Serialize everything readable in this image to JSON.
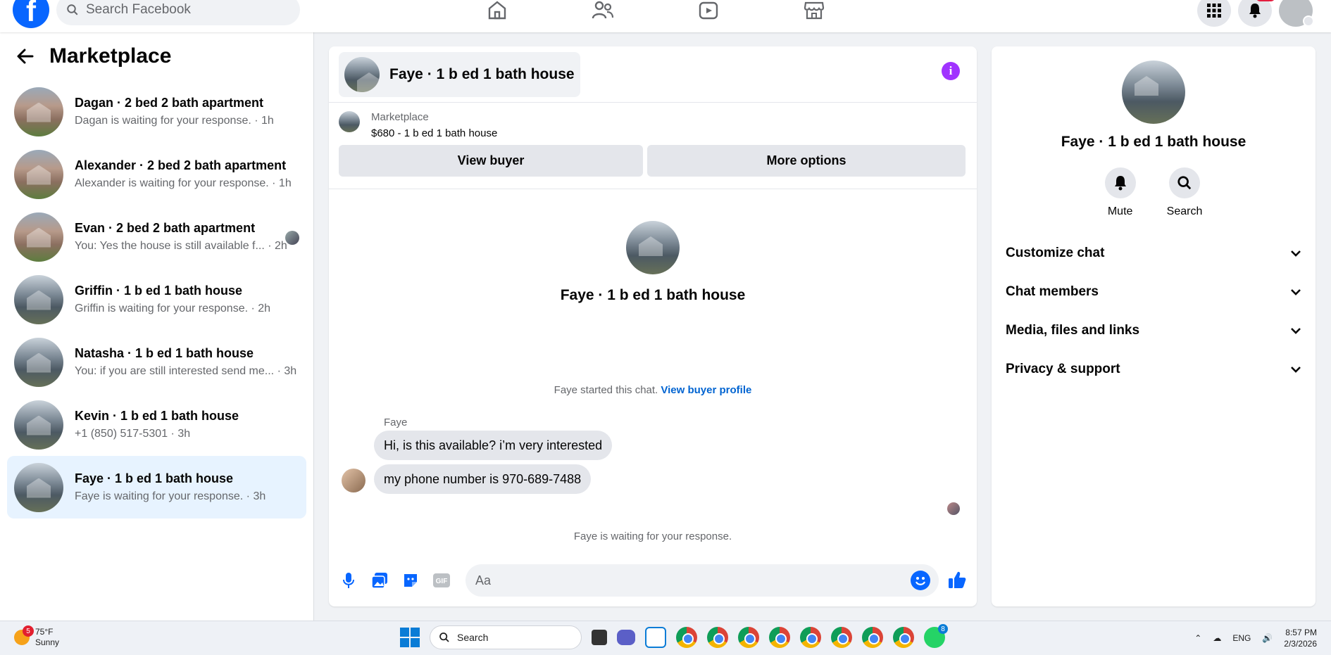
{
  "topbar": {
    "search_placeholder": "Search Facebook",
    "logo_letter": "f"
  },
  "sidebar": {
    "title": "Marketplace",
    "chats": [
      {
        "name": "Dagan · 2 bed 2 bath apartment",
        "preview": "Dagan is waiting for your response. · 1h",
        "photo": "brick"
      },
      {
        "name": "Alexander · 2 bed 2 bath apartment",
        "preview": "Alexander is waiting for your response. · 1h",
        "photo": "brick"
      },
      {
        "name": "Evan · 2 bed 2 bath apartment",
        "preview": "You: Yes the house is still available f... · 2h",
        "photo": "brick"
      },
      {
        "name": "Griffin · 1 b ed 1 bath house",
        "preview": "Griffin is waiting for your response. · 2h",
        "photo": "modern"
      },
      {
        "name": "Natasha · 1 b ed 1 bath house",
        "preview": "You: if you are still interested send me... · 3h",
        "photo": "modern"
      },
      {
        "name": "Kevin · 1 b ed 1 bath house",
        "preview": "+1 (850) 517-5301 · 3h",
        "photo": "modern"
      },
      {
        "name": "Faye · 1 b ed 1 bath house",
        "preview": "Faye is waiting for your response. · 3h",
        "photo": "modern",
        "active": true
      }
    ]
  },
  "conversation": {
    "title": "Faye · 1 b ed 1 bath house",
    "info_icon": "i",
    "marketplace_label": "Marketplace",
    "listing": "$680 - 1 b ed 1 bath house",
    "view_buyer": "View buyer",
    "more_options": "More options",
    "profile_name": "Faye · 1 b ed 1 bath house",
    "started_text": "Faye started this chat.",
    "buyer_profile_link": "View buyer profile",
    "sender": "Faye",
    "messages": [
      "Hi, is this available? i’m very interested",
      "my phone number is 970-689-7488"
    ],
    "waiting_text": "Faye is waiting for your response.",
    "composer_placeholder": "Aa"
  },
  "details": {
    "name": "Faye · 1 b ed 1 bath house",
    "mute_label": "Mute",
    "search_label": "Search",
    "sections": [
      "Customize chat",
      "Chat members",
      "Media, files and links",
      "Privacy & support"
    ]
  },
  "taskbar": {
    "weather_temp": "75°F",
    "weather_desc": "Sunny",
    "weather_badge": "5",
    "search_label": "Search",
    "lang": "ENG",
    "time": "8:57 PM",
    "date": "2/3/2026",
    "whatsapp_badge": "8"
  },
  "colors": {
    "accent": "#0866ff",
    "active_bg": "#e7f3ff",
    "info_purple": "#a033ff"
  }
}
